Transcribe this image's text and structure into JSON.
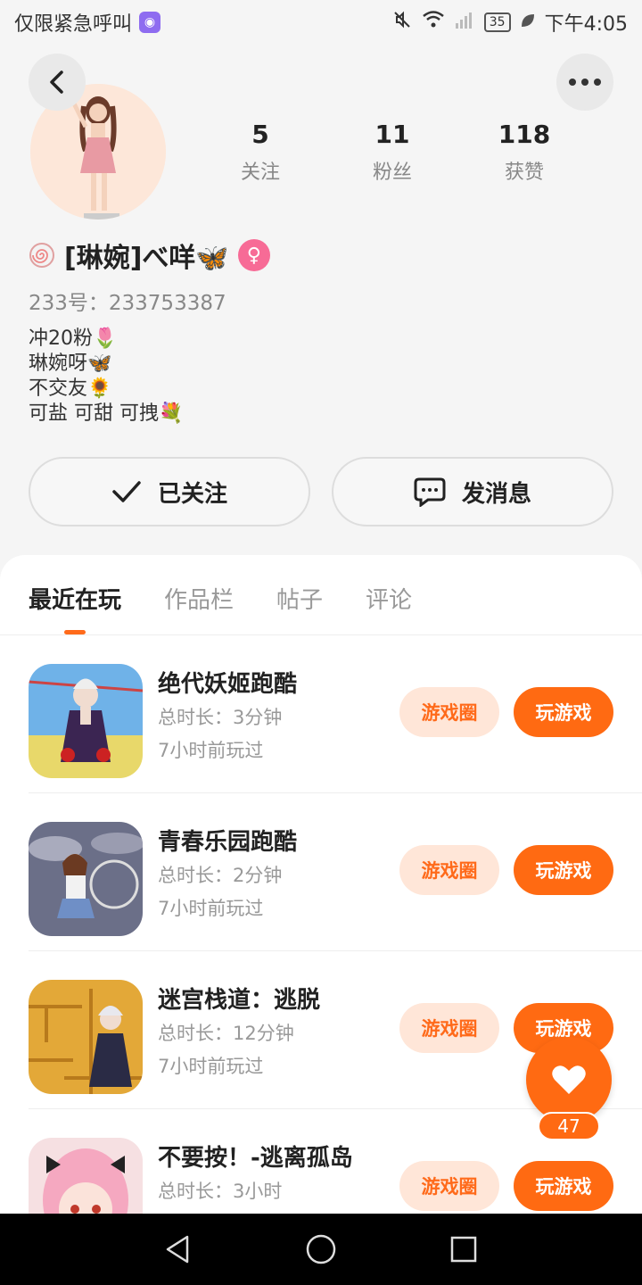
{
  "status_bar": {
    "left_text": "仅限紧急呼叫",
    "time": "下午4:05",
    "battery": "35"
  },
  "profile": {
    "stats": [
      {
        "value": "5",
        "label": "关注"
      },
      {
        "value": "11",
        "label": "粉丝"
      },
      {
        "value": "118",
        "label": "获赞"
      }
    ],
    "nickname": "[琳婉]べ咩🦋",
    "uid": "233号：233753387",
    "bio": [
      "冲20粉🌷",
      "琳婉呀🦋",
      "不交友🌻",
      "可盐 可甜 可拽💐"
    ],
    "follow_button": "已关注",
    "message_button": "发消息"
  },
  "tabs": [
    "最近在玩",
    "作品栏",
    "帖子",
    "评论"
  ],
  "games": [
    {
      "title": "绝代妖姬跑酷",
      "duration": "总时长：3分钟",
      "last_played": "7小时前玩过",
      "circle_btn": "游戏圈",
      "play_btn": "玩游戏"
    },
    {
      "title": "青春乐园跑酷",
      "duration": "总时长：2分钟",
      "last_played": "7小时前玩过",
      "circle_btn": "游戏圈",
      "play_btn": "玩游戏"
    },
    {
      "title": "迷宫栈道：逃脱",
      "duration": "总时长：12分钟",
      "last_played": "7小时前玩过",
      "circle_btn": "游戏圈",
      "play_btn": "玩游戏"
    },
    {
      "title": "不要按！-逃离孤岛",
      "duration": "总时长：3小时",
      "last_played": "",
      "circle_btn": "游戏圈",
      "play_btn": "玩游戏"
    }
  ],
  "like_fab": {
    "count": "47"
  },
  "colors": {
    "accent": "#ff6a12",
    "accent_light": "#ffe6d8"
  }
}
